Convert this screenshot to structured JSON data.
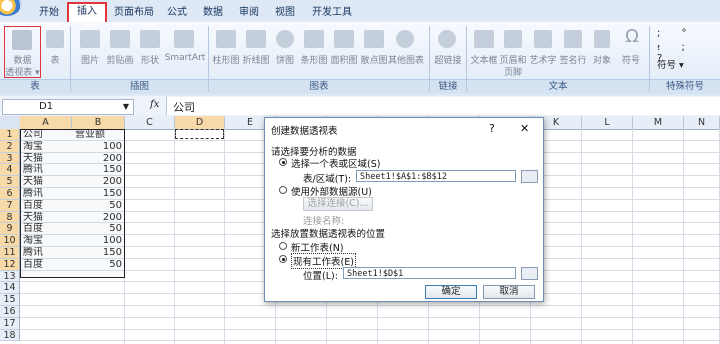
{
  "ribbon": {
    "tabs": [
      "开始",
      "插入",
      "页面布局",
      "公式",
      "数据",
      "审阅",
      "视图",
      "开发工具"
    ],
    "active_tab": "插入",
    "groups": {
      "table": {
        "label": "表",
        "pivot": "数据\n透视表",
        "pivot_line1": "数据",
        "pivot_line2": "透视表 ▾",
        "table_btn": "表"
      },
      "illustrations": {
        "label": "插图",
        "buttons": [
          "图片",
          "剪贴画",
          "形状",
          "SmartArt"
        ]
      },
      "charts": {
        "label": "图表",
        "buttons": [
          "柱形图",
          "折线图",
          "饼图",
          "条形图",
          "面积图",
          "散点图",
          "其他图表"
        ]
      },
      "links": {
        "label": "链接",
        "buttons": [
          "超链接"
        ]
      },
      "text": {
        "label": "文本",
        "buttons": [
          "文本框",
          "页眉和页脚",
          "艺术字",
          "签名行",
          "对象",
          "符号"
        ],
        "b2_line1": "页眉和",
        "b2_line2": "页脚"
      },
      "special": {
        "label": "特殊符号",
        "symbol_btn": "符号 ▾"
      }
    }
  },
  "formula_bar": {
    "name_box": "D1",
    "fx": "fx",
    "content": "公司"
  },
  "columns": [
    "A",
    "B",
    "C",
    "D",
    "E",
    "F",
    "G",
    "H",
    "I",
    "J",
    "K",
    "L",
    "M",
    "N"
  ],
  "rows": [
    "1",
    "2",
    "3",
    "4",
    "5",
    "6",
    "7",
    "8",
    "9",
    "10",
    "11",
    "12",
    "13",
    "14",
    "15",
    "16",
    "17",
    "18"
  ],
  "sheet": {
    "header": [
      "公司",
      "营业额"
    ],
    "data": [
      [
        "淘宝",
        "100"
      ],
      [
        "天猫",
        "200"
      ],
      [
        "腾讯",
        "150"
      ],
      [
        "天猫",
        "200"
      ],
      [
        "腾讯",
        "150"
      ],
      [
        "百度",
        "50"
      ],
      [
        "天猫",
        "200"
      ],
      [
        "百度",
        "50"
      ],
      [
        "淘宝",
        "100"
      ],
      [
        "腾讯",
        "150"
      ],
      [
        "百度",
        "50"
      ]
    ]
  },
  "dialog": {
    "title": "创建数据透视表",
    "help": "?",
    "close": "✕",
    "section1": "请选择要分析的数据",
    "opt_range": "选择一个表或区域(S)",
    "range_label": "表/区域(T):",
    "range_value": "Sheet1!$A$1:$B$12",
    "opt_external": "使用外部数据源(U)",
    "choose_conn": "选择连接(C)...",
    "conn_name": "连接名称:",
    "section2": "选择放置数据透视表的位置",
    "opt_new": "新工作表(N)",
    "opt_existing": "现有工作表(E)",
    "location_label": "位置(L):",
    "location_value": "Sheet1!$D$1",
    "ok": "确定",
    "cancel": "取消"
  }
}
